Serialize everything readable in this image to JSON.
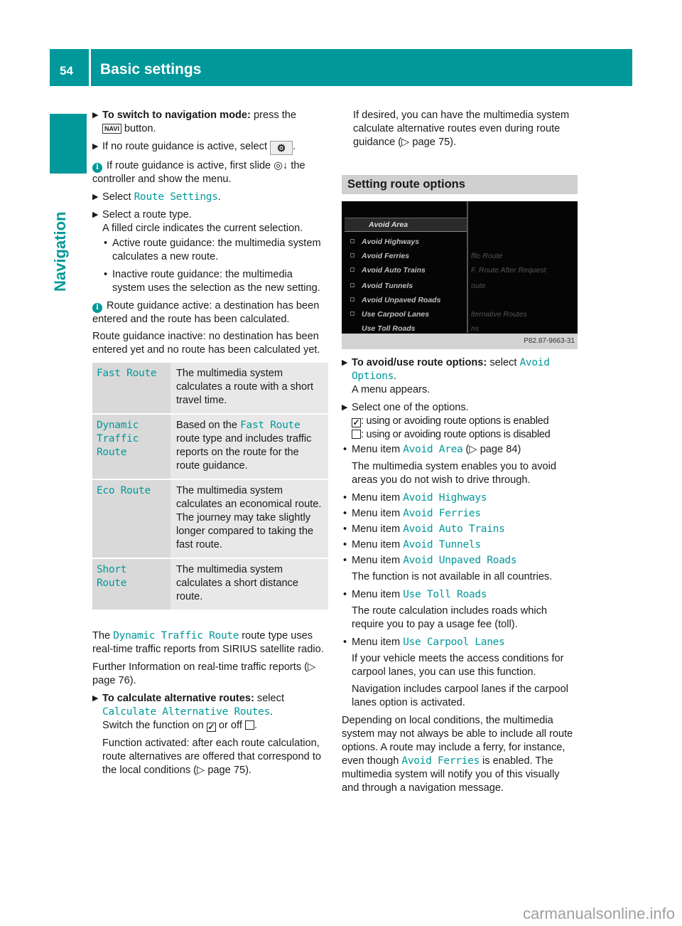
{
  "header": {
    "page_number": "54",
    "title": "Basic settings"
  },
  "side_tab": {
    "label": "Navigation"
  },
  "left": {
    "step1": {
      "bold": "To switch to navigation mode:",
      "text": " press the ",
      "key": "NAVI",
      "after": " button."
    },
    "step2": {
      "text": "If no route guidance is active, select ",
      "icon": "⚙",
      "after": "."
    },
    "info1": {
      "text": "If route guidance is active, first slide ◎↓ the controller and show the menu."
    },
    "step3": {
      "pre": "Select ",
      "link": "Route Settings",
      "post": "."
    },
    "step4": {
      "line1": "Select a route type.",
      "line2": "A filled circle indicates the current selection."
    },
    "bullets": [
      "Active route guidance: the multimedia system calculates a new route.",
      "Inactive route guidance: the multimedia system uses the selection as the new setting."
    ],
    "info2": {
      "p1": "Route guidance active: a destination has been entered and the route has been calculated.",
      "p2": "Route guidance inactive: no destination has been entered yet and no route has been calculated yet."
    },
    "route_table": [
      {
        "name": "Fast Route",
        "desc": "The multimedia system calculates a route with a short travel time."
      },
      {
        "name": "Dynamic Traffic Route",
        "desc_pre": "Based on the ",
        "desc_link": "Fast Route",
        "desc": " route type and includes traffic reports on the route for the route guidance."
      },
      {
        "name": "Eco Route",
        "desc": "The multimedia system calculates an economical route. The journey may take slightly longer compared to taking the fast route."
      },
      {
        "name": "Short Route",
        "desc": "The multimedia system calculates a short distance route."
      }
    ],
    "para1": {
      "pre": "The ",
      "link": "Dynamic Traffic Route",
      "post": " route type uses real-time traffic reports from SIRIUS satellite radio."
    },
    "para2": "Further Information on real-time traffic reports (▷ page 76).",
    "step5": {
      "bold": "To calculate alternative routes:",
      "text": " select ",
      "link": "Calculate Alternative Routes",
      "post": ".",
      "line2_pre": "Switch the function on ",
      "line2_mid": " or off ",
      "line2_post": "."
    },
    "para3": "Function activated: after each route calculation, route alternatives are offered that correspond to the local conditions (▷ page 75)."
  },
  "right": {
    "para1": "If desired, you can have the multimedia system calculate alternative routes even during route guidance (▷ page 75).",
    "section_title": "Setting route options",
    "screen": {
      "header": "Avoid Area",
      "items": [
        "Avoid Highways",
        "Avoid Ferries",
        "Avoid Auto Trains",
        "Avoid Tunnels",
        "Avoid Unpaved Roads",
        "Use Carpool Lanes",
        "Use Toll Roads"
      ],
      "right_items": [
        "ffic Route",
        "F. Route After Request",
        "oute",
        "lternative Routes",
        "ns"
      ],
      "caption": "P82.87-9663-31"
    },
    "step1": {
      "bold": "To avoid/use route options:",
      "text": " select ",
      "link": "Avoid Options",
      "post": ".",
      "line2": "A menu appears."
    },
    "step2": {
      "line1": "Select one of the options.",
      "enabled": ": using or avoiding route options is enabled",
      "disabled": ": using or avoiding route options is disabled"
    },
    "menu_items": [
      {
        "pre": "Menu item ",
        "link": "Avoid Area",
        "post": " (▷ page 84)",
        "note": "The multimedia system enables you to avoid areas you do not wish to drive through."
      },
      {
        "pre": "Menu item ",
        "link": "Avoid Highways"
      },
      {
        "pre": "Menu item ",
        "link": "Avoid Ferries"
      },
      {
        "pre": "Menu item ",
        "link": "Avoid Auto Trains"
      },
      {
        "pre": "Menu item ",
        "link": "Avoid Tunnels"
      },
      {
        "pre": "Menu item ",
        "link": "Avoid Unpaved Roads",
        "note": "The function is not available in all countries."
      },
      {
        "pre": "Menu item ",
        "link": "Use Toll Roads",
        "note": "The route calculation includes roads which require you to pay a usage fee (toll)."
      },
      {
        "pre": "Menu item ",
        "link": "Use Carpool Lanes",
        "note": "If your vehicle meets the access conditions for carpool lanes, you can use this function.",
        "note2": "Navigation includes carpool lanes if the carpool lanes option is activated."
      }
    ],
    "final": {
      "pre": "Depending on local conditions, the multimedia system may not always be able to include all route options. A route may include a ferry, for instance, even though ",
      "link": "Avoid Ferries",
      "post": " is enabled. The multimedia system will notify you of this visually and through a navigation message."
    }
  },
  "watermark": "carmanualsonline.info",
  "colors": {
    "accent": "#00989a",
    "table_name_bg": "#d9d9d9",
    "table_desc_bg": "#e8e8e8"
  }
}
